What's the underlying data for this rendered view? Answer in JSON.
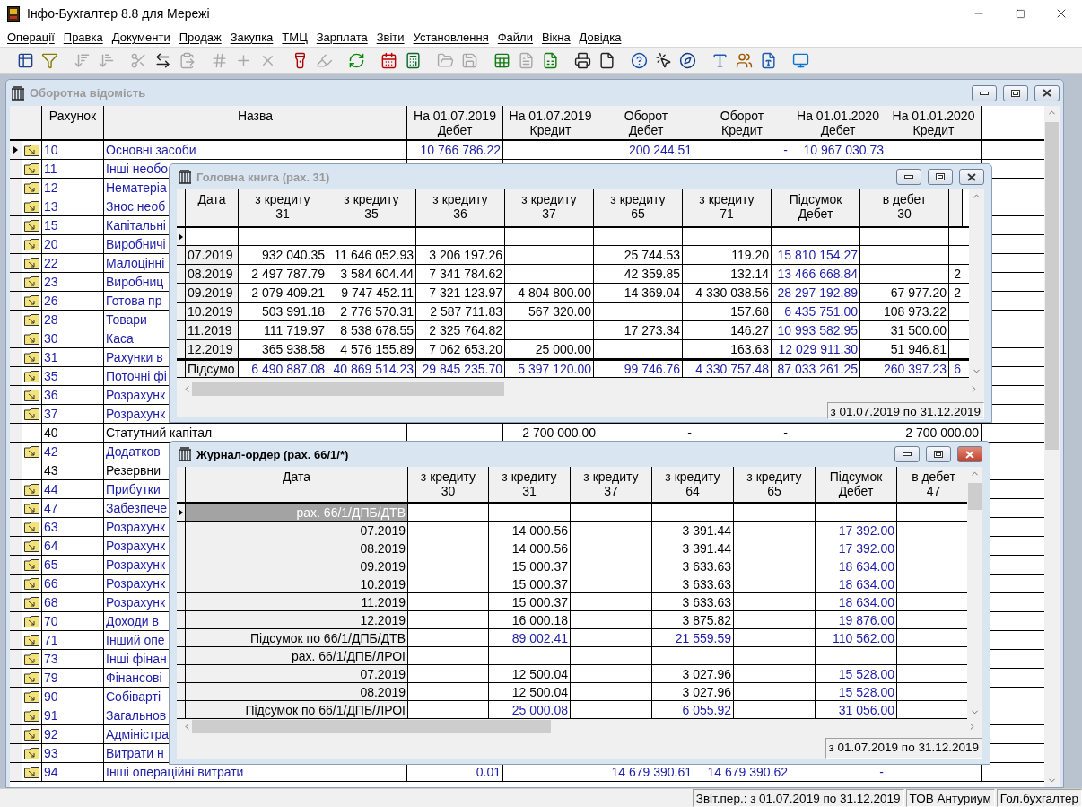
{
  "window": {
    "title": "Інфо-Бухгалтер 8.8 для Мережі"
  },
  "menu": [
    {
      "label": "Операції"
    },
    {
      "label": "Правка"
    },
    {
      "label": "Документи"
    },
    {
      "label": "Продаж"
    },
    {
      "label": "Закупка"
    },
    {
      "label": "ТМЦ"
    },
    {
      "label": "Зарплата"
    },
    {
      "label": "Звіти"
    },
    {
      "label": "Установлення"
    },
    {
      "label": "Файли"
    },
    {
      "label": "Вікна"
    },
    {
      "label": "Довідка"
    }
  ],
  "toolbar": [
    {
      "disabled": false
    },
    {
      "disabled": false
    },
    {
      "disabled": true
    },
    {
      "disabled": true
    },
    {
      "disabled": true
    },
    {
      "disabled": false
    },
    {
      "disabled": true
    },
    {
      "disabled": true
    },
    {
      "disabled": true
    },
    {
      "disabled": true
    },
    {
      "disabled": false
    },
    {
      "disabled": true
    },
    {
      "disabled": false
    },
    {
      "disabled": false
    },
    {
      "disabled": false
    },
    {
      "disabled": true
    },
    {
      "disabled": true
    },
    {
      "disabled": false
    },
    {
      "disabled": true
    },
    {
      "disabled": false
    },
    {
      "disabled": false
    },
    {
      "disabled": false
    },
    {
      "disabled": false
    },
    {
      "disabled": false
    },
    {
      "disabled": false
    },
    {
      "disabled": false
    },
    {
      "disabled": false
    },
    {
      "disabled": false
    },
    {
      "disabled": false
    }
  ],
  "balance_sheet": {
    "title": "Оборотна відомість",
    "active": false,
    "columns": [
      {
        "label": "Рахунок"
      },
      {
        "label": "Назва"
      },
      {
        "label": "На 01.07.2019\nДебет"
      },
      {
        "label": "На 01.07.2019\nКредит"
      },
      {
        "label": "Оборот\nДебет"
      },
      {
        "label": "Оборот\nКредит"
      },
      {
        "label": "На 01.01.2020\nДебет"
      },
      {
        "label": "На 01.01.2020\nКредит"
      }
    ],
    "rows": [
      {
        "account": "10",
        "name": "Основні засоби",
        "group": true,
        "selected": true,
        "values": {
          "opening_debit": "10 766 786.22",
          "turnover_debit": "200 244.51",
          "turnover_credit": "-",
          "closing_debit": "10 967 030.73"
        }
      },
      {
        "account": "11",
        "name": "Інші необо",
        "group": true,
        "selected": false
      },
      {
        "account": "12",
        "name": "Нематеріа",
        "group": true,
        "selected": false
      },
      {
        "account": "13",
        "name": "Знос необ",
        "group": true,
        "selected": false
      },
      {
        "account": "15",
        "name": "Капітальні",
        "group": true,
        "selected": false
      },
      {
        "account": "20",
        "name": "Виробничі",
        "group": true,
        "selected": false
      },
      {
        "account": "22",
        "name": "Малоцінні",
        "group": true,
        "selected": false
      },
      {
        "account": "23",
        "name": "Виробниц",
        "group": true,
        "selected": false
      },
      {
        "account": "26",
        "name": "Готова пр",
        "group": true,
        "selected": false
      },
      {
        "account": "28",
        "name": "Товари",
        "group": true,
        "selected": false
      },
      {
        "account": "30",
        "name": "Каса",
        "group": true,
        "selected": false
      },
      {
        "account": "31",
        "name": "Рахунки в",
        "group": true,
        "selected": false
      },
      {
        "account": "35",
        "name": "Поточні фі",
        "group": true,
        "selected": false
      },
      {
        "account": "36",
        "name": "Розрахунк",
        "group": true,
        "selected": false
      },
      {
        "account": "37",
        "name": "Розрахунк",
        "group": true,
        "selected": false
      },
      {
        "account": "40",
        "name": "Статутний капітал",
        "group": false,
        "selected": false,
        "values": {
          "opening_credit": "2 700 000.00",
          "turnover_debit": "-",
          "turnover_credit": "-",
          "closing_credit": "2 700 000.00"
        }
      },
      {
        "account": "42",
        "name": "Додатков",
        "group": true,
        "selected": false
      },
      {
        "account": "43",
        "name": "Резервни",
        "group": false,
        "selected": false
      },
      {
        "account": "44",
        "name": "Прибутки",
        "group": true,
        "selected": false
      },
      {
        "account": "47",
        "name": "Забезпече",
        "group": true,
        "selected": false
      },
      {
        "account": "63",
        "name": "Розрахунк",
        "group": true,
        "selected": false
      },
      {
        "account": "64",
        "name": "Розрахунк",
        "group": true,
        "selected": false
      },
      {
        "account": "65",
        "name": "Розрахунк",
        "group": true,
        "selected": false
      },
      {
        "account": "66",
        "name": "Розрахунк",
        "group": true,
        "selected": false
      },
      {
        "account": "68",
        "name": "Розрахунк",
        "group": true,
        "selected": false
      },
      {
        "account": "70",
        "name": "Доходи в",
        "group": true,
        "selected": false
      },
      {
        "account": "71",
        "name": "Інший опе",
        "group": true,
        "selected": false
      },
      {
        "account": "73",
        "name": "Інші фінан",
        "group": true,
        "selected": false
      },
      {
        "account": "79",
        "name": "Фінансові",
        "group": true,
        "selected": false
      },
      {
        "account": "90",
        "name": "Собіварті",
        "group": true,
        "selected": false
      },
      {
        "account": "91",
        "name": "Загальнов",
        "group": true,
        "selected": false
      },
      {
        "account": "92",
        "name": "Адміністра",
        "group": true,
        "selected": false
      },
      {
        "account": "93",
        "name": "Витрати н",
        "group": true,
        "selected": false
      },
      {
        "account": "94",
        "name": "Інші операційні  витрати",
        "group": true,
        "selected": false,
        "values": {
          "opening_debit": "0.01",
          "turnover_debit": "14 679 390.61",
          "turnover_credit": "14 679 390.62",
          "closing_debit": "-"
        }
      }
    ]
  },
  "ledger": {
    "title": "Головна книга (рах. 31)",
    "active": false,
    "columns": [
      {
        "label": "Дата"
      },
      {
        "label": "з кредиту\n31"
      },
      {
        "label": "з кредиту\n35"
      },
      {
        "label": "з кредиту\n36"
      },
      {
        "label": "з кредиту\n37"
      },
      {
        "label": "з кредиту\n65"
      },
      {
        "label": "з кредиту\n71"
      },
      {
        "label": "Підсумок\nДебет",
        "summary": true
      },
      {
        "label": "в дебет\n30"
      }
    ],
    "rows": [
      {
        "kind": "blank",
        "selected": true
      },
      {
        "kind": "month",
        "selected": false,
        "cells": {
          "date": "07.2019",
          "cr_31": "932 040.35",
          "cr_35": "11 646 052.93",
          "cr_36": "3 206 197.26",
          "cr_65": "25 744.53",
          "cr_71": "119.20",
          "total_debit": "15 810 154.27"
        }
      },
      {
        "kind": "month",
        "selected": false,
        "cells": {
          "date": "08.2019",
          "cr_31": "2 497 787.79",
          "cr_35": "3 584 604.44",
          "cr_36": "7 341 784.62",
          "cr_65": "42 359.85",
          "cr_71": "132.14",
          "total_debit": "13 466 668.84",
          "column_10": "2"
        }
      },
      {
        "kind": "month",
        "selected": false,
        "cells": {
          "date": "09.2019",
          "cr_31": "2 079 409.21",
          "cr_35": "9 747 452.11",
          "cr_36": "7 321 123.97",
          "cr_37": "4 804 800.00",
          "cr_65": "14 369.04",
          "cr_71": "4 330 038.56",
          "total_debit": "28 297 192.89",
          "dr_30": "67 977.20",
          "column_10": "2"
        }
      },
      {
        "kind": "month",
        "selected": false,
        "cells": {
          "date": "10.2019",
          "cr_31": "503 991.18",
          "cr_35": "2 776 570.31",
          "cr_36": "2 587 711.83",
          "cr_37": "567 320.00",
          "cr_71": "157.68",
          "total_debit": "6 435 751.00",
          "dr_30": "108 973.22"
        }
      },
      {
        "kind": "month",
        "selected": false,
        "cells": {
          "date": "11.2019",
          "cr_31": "111 719.97",
          "cr_35": "8 538 678.55",
          "cr_36": "2 325 764.82",
          "cr_65": "17 273.34",
          "cr_71": "146.27",
          "total_debit": "10 993 582.95",
          "dr_30": "31 500.00"
        }
      },
      {
        "kind": "month",
        "selected": false,
        "cells": {
          "date": "12.2019",
          "cr_31": "365 938.58",
          "cr_35": "4 576 155.89",
          "cr_36": "7 062 653.20",
          "cr_37": "25 000.00",
          "cr_71": "163.63",
          "total_debit": "12 029 911.30",
          "dr_30": "51 946.81"
        }
      },
      {
        "kind": "total",
        "selected": false,
        "cells": {
          "date": "Підсумо",
          "cr_31": "6 490 887.08",
          "cr_35": "40 869 514.23",
          "cr_36": "29 845 235.70",
          "cr_37": "5 397 120.00",
          "cr_65": "99 746.76",
          "cr_71": "4 330 757.48",
          "total_debit": "87 033 261.25",
          "dr_30": "260 397.23",
          "column_10": "6"
        }
      }
    ],
    "period": "з 01.07.2019 по 31.12.2019"
  },
  "journal": {
    "title": "Журнал-ордер (рах. 66/1/*)",
    "active": true,
    "columns": [
      {
        "label": "Дата"
      },
      {
        "label": "з кредиту\n30"
      },
      {
        "label": "з кредиту\n31"
      },
      {
        "label": "з кредиту\n37"
      },
      {
        "label": "з кредиту\n64"
      },
      {
        "label": "з кредиту\n65"
      },
      {
        "label": "Підсумок\nДебет",
        "summary": true
      },
      {
        "label": "в дебет\n47"
      }
    ],
    "rows": [
      {
        "kind": "group",
        "selected": true,
        "cells": {
          "date": "рах. 66/1/ДПБ/ДТВ"
        }
      },
      {
        "kind": "month",
        "selected": false,
        "cells": {
          "date": "07.2019",
          "cr_31": "14 000.56",
          "cr_64": "3 391.44",
          "total_debit": "17 392.00"
        }
      },
      {
        "kind": "month",
        "selected": false,
        "cells": {
          "date": "08.2019",
          "cr_31": "14 000.56",
          "cr_64": "3 391.44",
          "total_debit": "17 392.00"
        }
      },
      {
        "kind": "month",
        "selected": false,
        "cells": {
          "date": "09.2019",
          "cr_31": "15 000.37",
          "cr_64": "3 633.63",
          "total_debit": "18 634.00"
        }
      },
      {
        "kind": "month",
        "selected": false,
        "cells": {
          "date": "10.2019",
          "cr_31": "15 000.37",
          "cr_64": "3 633.63",
          "total_debit": "18 634.00"
        }
      },
      {
        "kind": "month",
        "selected": false,
        "cells": {
          "date": "11.2019",
          "cr_31": "15 000.37",
          "cr_64": "3 633.63",
          "total_debit": "18 634.00"
        }
      },
      {
        "kind": "month",
        "selected": false,
        "cells": {
          "date": "12.2019",
          "cr_31": "16 000.18",
          "cr_64": "3 875.82",
          "total_debit": "19 876.00"
        }
      },
      {
        "kind": "total",
        "selected": false,
        "cells": {
          "date": "Підсумок по 66/1/ДПБ/ДТВ",
          "cr_31": "89 002.41",
          "cr_64": "21 559.59",
          "total_debit": "110 562.00"
        }
      },
      {
        "kind": "group",
        "selected": false,
        "cells": {
          "date": "рах. 66/1/ДПБ/ЛРОІ"
        }
      },
      {
        "kind": "month",
        "selected": false,
        "cells": {
          "date": "07.2019",
          "cr_31": "12 500.04",
          "cr_64": "3 027.96",
          "total_debit": "15 528.00"
        }
      },
      {
        "kind": "month",
        "selected": false,
        "cells": {
          "date": "08.2019",
          "cr_31": "12 500.04",
          "cr_64": "3 027.96",
          "total_debit": "15 528.00"
        }
      },
      {
        "kind": "total",
        "selected": false,
        "cells": {
          "date": "Підсумок по 66/1/ДПБ/ЛРОІ",
          "cr_31": "25 000.08",
          "cr_64": "6 055.92",
          "total_debit": "31 056.00"
        }
      }
    ],
    "period": "з 01.07.2019 по 31.12.2019"
  },
  "status_bar": [
    {
      "text": "Звіт.пер.: з 01.07.2019 по 31.12.2019"
    },
    {
      "text": "ТОВ Антуриум"
    },
    {
      "text": "Гол.бухгалтер"
    }
  ]
}
